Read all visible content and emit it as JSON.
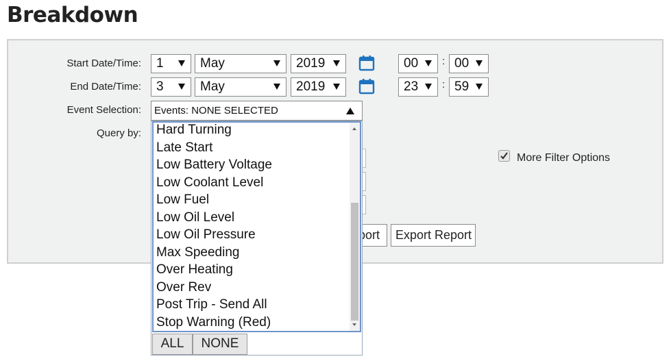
{
  "page": {
    "title": "Breakdown"
  },
  "filters": {
    "start_label": "Start Date/Time:",
    "end_label": "End Date/Time:",
    "event_label": "Event Selection:",
    "query_label": "Query by:",
    "start": {
      "day": "1",
      "month": "May",
      "year": "2019",
      "hour": "00",
      "minute": "00"
    },
    "end": {
      "day": "3",
      "month": "May",
      "year": "2019",
      "hour": "23",
      "minute": "59"
    },
    "time_separator": ":",
    "events_value": "Events: NONE SELECTED",
    "more_filter_label": "More Filter Options",
    "more_filter_checked": true,
    "view_report_partial": "port",
    "export_report_label": "Export Report"
  },
  "events_dropdown": {
    "items": [
      "Hard Turning",
      "Late Start",
      "Low Battery Voltage",
      "Low Coolant Level",
      "Low Fuel",
      "Low Oil Level",
      "Low Oil Pressure",
      "Max Speeding",
      "Over Heating",
      "Over Rev",
      "Post Trip - Send All",
      "Stop Warning (Red)"
    ],
    "all_label": "ALL",
    "none_label": "NONE"
  },
  "colors": {
    "accent": "#1e73be",
    "panel_bg": "#f0f1f1",
    "dropdown_border": "#6f93c9"
  },
  "icons": {
    "calendar": "calendar-icon",
    "checkmark": "checkmark-icon"
  }
}
